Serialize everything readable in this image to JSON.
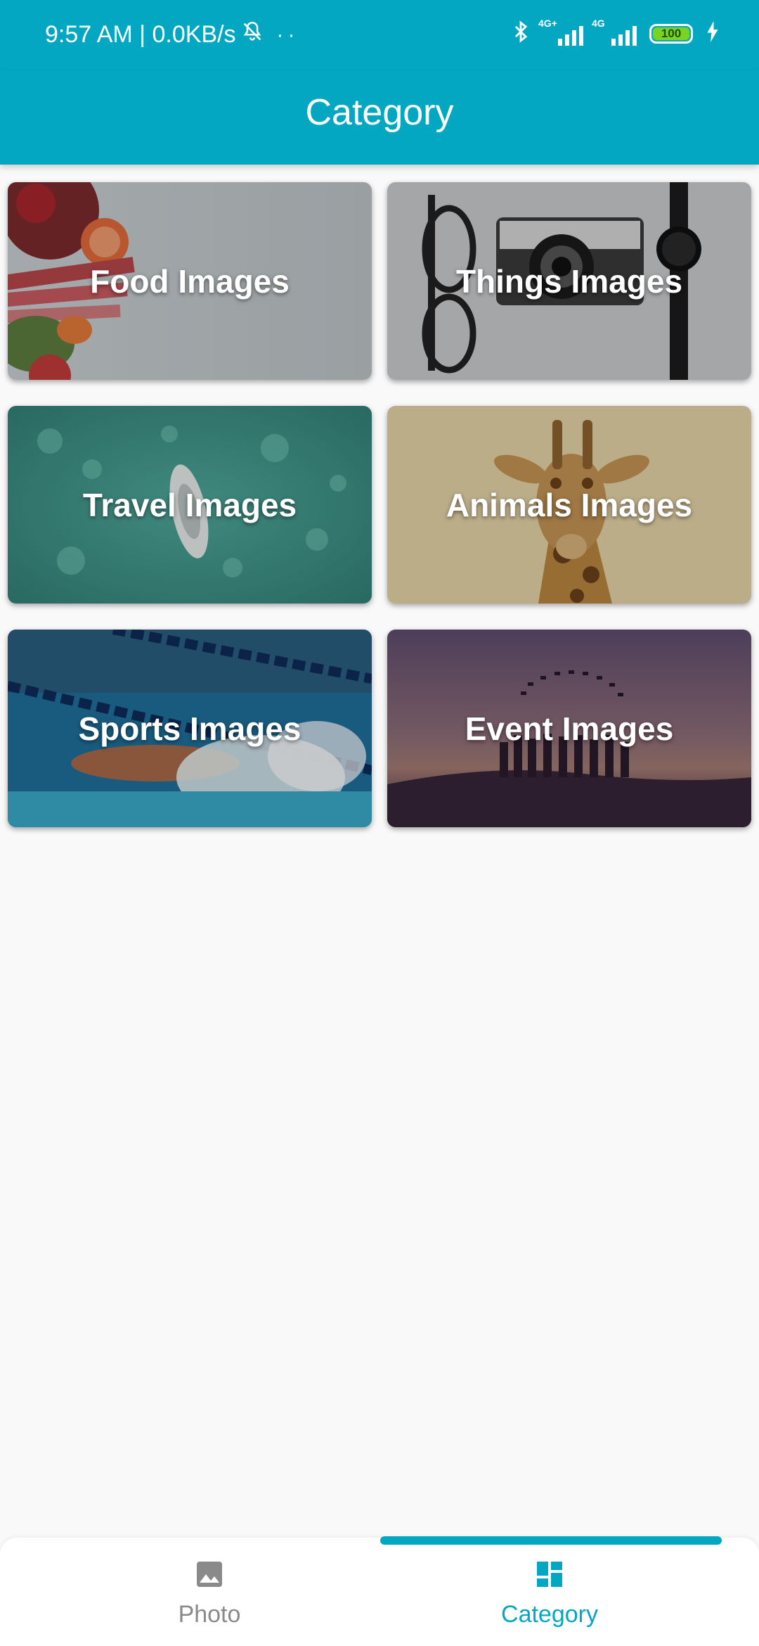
{
  "status_bar": {
    "time": "9:57 AM | 0.0KB/s",
    "signal1_tag": "4G+",
    "signal2_tag": "4G",
    "battery": "100"
  },
  "app_bar": {
    "title": "Category"
  },
  "categories": [
    {
      "label": "Food Images"
    },
    {
      "label": "Things Images"
    },
    {
      "label": "Travel Images"
    },
    {
      "label": "Animals Images"
    },
    {
      "label": "Sports Images"
    },
    {
      "label": "Event Images"
    }
  ],
  "bottom_nav": {
    "photo_label": "Photo",
    "category_label": "Category",
    "active": "Category"
  },
  "colors": {
    "primary": "#03a7c2",
    "background": "#f9f9f9"
  }
}
